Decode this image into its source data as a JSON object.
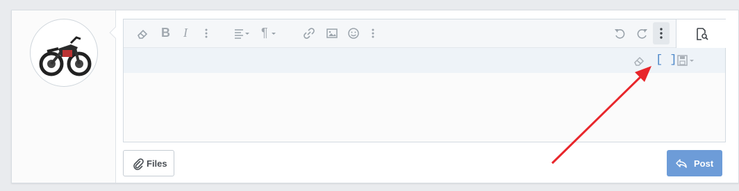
{
  "editor": {
    "toolbar": {
      "remove_format_icon": "eraser-icon",
      "bold_label": "B",
      "italic_label": "I",
      "more_text_icon": "vertical-ellipsis-icon",
      "align_icon": "align-left-icon",
      "paragraph_label": "¶",
      "link_icon": "link-icon",
      "image_icon": "image-icon",
      "emoji_icon": "smiley-icon",
      "more_insert_icon": "vertical-ellipsis-icon",
      "undo_icon": "undo-icon",
      "redo_icon": "redo-icon",
      "more_misc_icon": "vertical-ellipsis-icon",
      "preview_icon": "document-search-icon"
    },
    "subbar": {
      "clear_icon": "eraser-icon",
      "bbcode_toggle_label": "[ ]",
      "drafts_icon": "floppy-disk-icon"
    }
  },
  "actions": {
    "files_label": "Files",
    "files_icon": "paperclip-icon",
    "post_label": "Post",
    "post_icon": "reply-arrow-icon"
  },
  "annotation": {
    "arrow_color": "#e8262b"
  },
  "colors": {
    "post_button": "#6d9cd8",
    "bbcode_toggle": "#4a86c8"
  }
}
